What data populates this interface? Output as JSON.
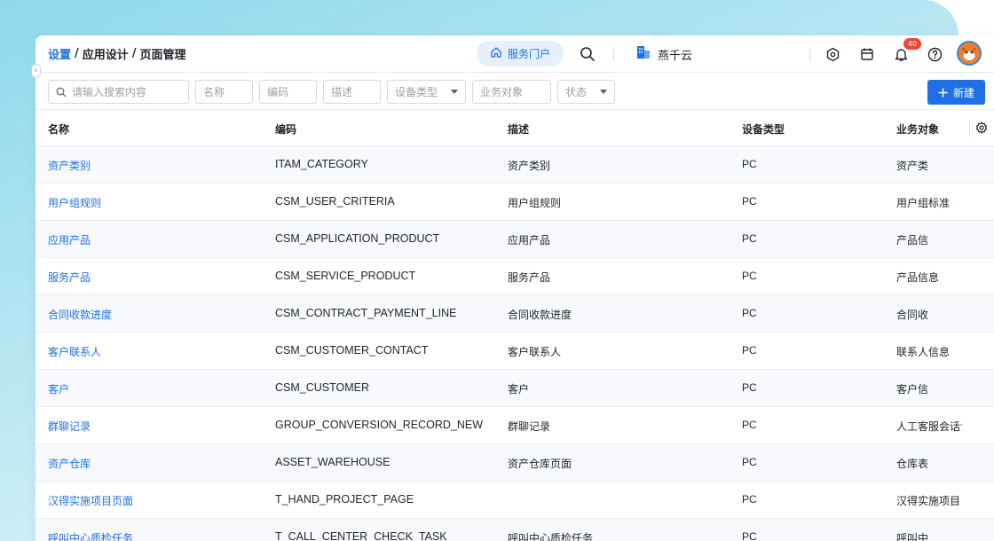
{
  "breadcrumb": {
    "root": "设置",
    "sep": "/",
    "mid": "应用设计",
    "current": "页面管理"
  },
  "header": {
    "service_portal": "服务门户",
    "tenant": "燕千云",
    "notification_count": "40"
  },
  "filters": {
    "search_placeholder": "请输入搜索内容",
    "name": "名称",
    "code": "编码",
    "desc": "描述",
    "device_type": "设备类型",
    "business_object": "业务对象",
    "status": "状态",
    "new_button": "新建"
  },
  "table": {
    "columns": [
      "名称",
      "编码",
      "描述",
      "设备类型",
      "业务对象"
    ],
    "rows": [
      {
        "name": "资产类别",
        "code": "ITAM_CATEGORY",
        "desc": "资产类别",
        "device": "PC",
        "object": "资产类"
      },
      {
        "name": "用户组规则",
        "code": "CSM_USER_CRITERIA",
        "desc": "用户组规则",
        "device": "PC",
        "object": "用户组标准"
      },
      {
        "name": "应用产品",
        "code": "CSM_APPLICATION_PRODUCT",
        "desc": "应用产品",
        "device": "PC",
        "object": "产品信"
      },
      {
        "name": "服务产品",
        "code": "CSM_SERVICE_PRODUCT",
        "desc": "服务产品",
        "device": "PC",
        "object": "产品信息"
      },
      {
        "name": "合同收款进度",
        "code": "CSM_CONTRACT_PAYMENT_LINE",
        "desc": "合同收款进度",
        "device": "PC",
        "object": "合同收"
      },
      {
        "name": "客户联系人",
        "code": "CSM_CUSTOMER_CONTACT",
        "desc": "客户联系人",
        "device": "PC",
        "object": "联系人信息"
      },
      {
        "name": "客户",
        "code": "CSM_CUSTOMER",
        "desc": "客户",
        "device": "PC",
        "object": "客户信"
      },
      {
        "name": "群聊记录",
        "code": "GROUP_CONVERSION_RECORD_NEW",
        "desc": "群聊记录",
        "device": "PC",
        "object": "人工客服会话记录"
      },
      {
        "name": "资产仓库",
        "code": "ASSET_WAREHOUSE",
        "desc": "资产仓库页面",
        "device": "PC",
        "object": "仓库表"
      },
      {
        "name": "汉得实施项目页面",
        "code": "T_HAND_PROJECT_PAGE",
        "desc": "",
        "device": "PC",
        "object": "汉得实施项目"
      },
      {
        "name": "呼叫中心质检任务",
        "code": "T_CALL_CENTER_CHECK_TASK",
        "desc": "呼叫中心质检任务",
        "device": "PC",
        "object": "呼叫中"
      }
    ]
  },
  "colors": {
    "primary": "#1f6fe5",
    "badge": "#f04438"
  }
}
